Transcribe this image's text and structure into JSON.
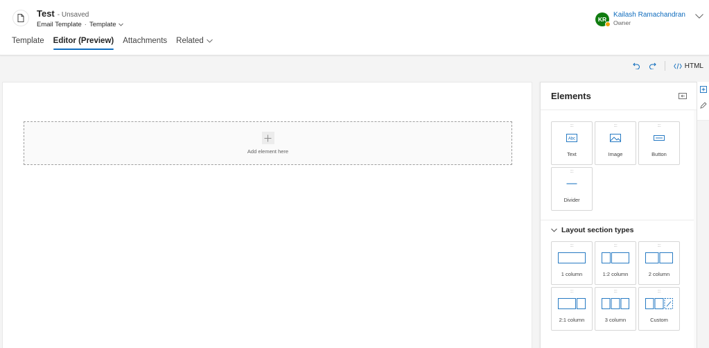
{
  "header": {
    "title": "Test",
    "status": "- Unsaved",
    "subtitle_entity": "Email Template",
    "subtitle_separator": "·",
    "subtitle_form": "Template",
    "tabs": [
      {
        "label": "Template",
        "active": false
      },
      {
        "label": "Editor (Preview)",
        "active": true
      },
      {
        "label": "Attachments",
        "active": false
      },
      {
        "label": "Related",
        "active": false
      }
    ],
    "user": {
      "initials": "KR",
      "name": "Kailash Ramachandran",
      "role": "Owner"
    }
  },
  "toolbar": {
    "undo_icon": "undo-icon",
    "redo_icon": "redo-icon",
    "html_label": "HTML"
  },
  "canvas": {
    "drop_label": "Add element here"
  },
  "panel": {
    "title": "Elements",
    "elements": [
      {
        "label": "Text",
        "icon": "text-icon"
      },
      {
        "label": "Image",
        "icon": "image-icon"
      },
      {
        "label": "Button",
        "icon": "button-icon"
      },
      {
        "label": "Divider",
        "icon": "divider-icon"
      }
    ],
    "layout_title": "Layout section types",
    "layouts": [
      {
        "label": "1 column"
      },
      {
        "label": "1:2 column"
      },
      {
        "label": "2 column"
      },
      {
        "label": "2:1 column"
      },
      {
        "label": "3 column"
      },
      {
        "label": "Custom"
      }
    ],
    "grip": "::::"
  },
  "colors": {
    "accent": "#0f6cbd",
    "avatar": "#107c10",
    "presence": "#f0a30a"
  }
}
